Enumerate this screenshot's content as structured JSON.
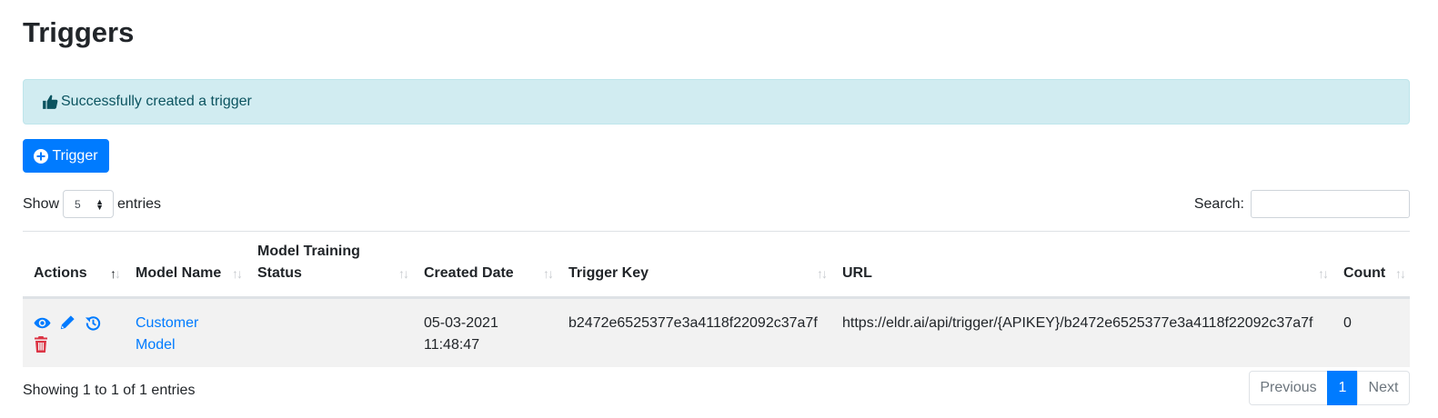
{
  "page": {
    "title": "Triggers"
  },
  "alert": {
    "icon": "thumbs-up-icon",
    "message": "Successfully created a trigger"
  },
  "toolbar": {
    "add_button_icon": "plus-circle-icon",
    "add_button_label": "Trigger"
  },
  "length": {
    "show_label": "Show",
    "selected": "5",
    "entries_label": "entries"
  },
  "search": {
    "label": "Search:",
    "value": ""
  },
  "table": {
    "columns": [
      {
        "label": "Actions"
      },
      {
        "label": "Model Name"
      },
      {
        "label": "Model Training Status"
      },
      {
        "label": "Created Date"
      },
      {
        "label": "Trigger Key"
      },
      {
        "label": "URL"
      },
      {
        "label": "Count"
      }
    ],
    "rows": [
      {
        "action_icons": [
          "eye-icon",
          "pencil-icon",
          "history-icon",
          "trash-icon"
        ],
        "model_name": "Customer Model",
        "model_training_status": "",
        "created_date": "05-03-2021 11:48:47",
        "trigger_key": "b2472e6525377e3a4118f22092c37a7f",
        "url": "https://eldr.ai/api/trigger/{APIKEY}/b2472e6525377e3a4118f22092c37a7f",
        "count": "0"
      }
    ]
  },
  "footer": {
    "info": "Showing 1 to 1 of 1 entries",
    "pagination": {
      "previous": "Previous",
      "pages": [
        "1"
      ],
      "current": "1",
      "next": "Next"
    }
  },
  "colors": {
    "primary": "#007bff",
    "danger": "#dc3545",
    "alert_bg": "#d1ecf1",
    "alert_text": "#0c5460"
  }
}
